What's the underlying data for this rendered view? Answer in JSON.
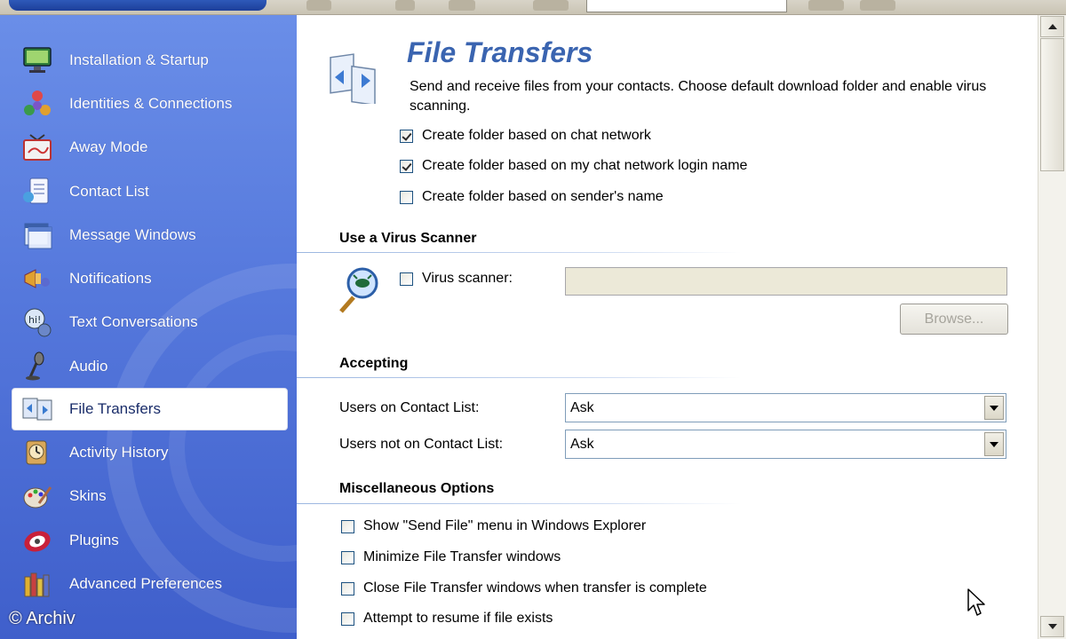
{
  "app": {
    "watermark": "© Archiv"
  },
  "sidebar": {
    "items": [
      {
        "label": "Installation & Startup",
        "icon": "monitor-icon"
      },
      {
        "label": "Identities & Connections",
        "icon": "connections-icon"
      },
      {
        "label": "Away Mode",
        "icon": "away-sign-icon"
      },
      {
        "label": "Contact List",
        "icon": "contact-list-icon"
      },
      {
        "label": "Message Windows",
        "icon": "message-windows-icon"
      },
      {
        "label": "Notifications",
        "icon": "notifications-icon"
      },
      {
        "label": "Text Conversations",
        "icon": "text-conversations-icon"
      },
      {
        "label": "Audio",
        "icon": "microphone-icon"
      },
      {
        "label": "File Transfers",
        "icon": "file-transfers-icon",
        "active": true
      },
      {
        "label": "Activity History",
        "icon": "activity-history-icon"
      },
      {
        "label": "Skins",
        "icon": "skins-icon"
      },
      {
        "label": "Plugins",
        "icon": "plugins-icon"
      },
      {
        "label": "Advanced Preferences",
        "icon": "advanced-preferences-icon"
      }
    ]
  },
  "main": {
    "title": "File Transfers",
    "description": "Send and receive files from your contacts.  Choose default download folder and enable virus scanning.",
    "folder_options": [
      {
        "label": "Create folder based on chat network",
        "checked": true
      },
      {
        "label": "Create folder based on my chat network login name",
        "checked": true
      },
      {
        "label": "Create folder based on sender's name",
        "checked": false
      }
    ],
    "virus": {
      "heading": "Use a Virus Scanner",
      "checkbox_label": "Virus scanner:",
      "checked": false,
      "path_value": "",
      "browse_label": "Browse..."
    },
    "accepting": {
      "heading": "Accepting",
      "on_list_label": "Users on Contact List:",
      "on_list_value": "Ask",
      "off_list_label": "Users not on Contact List:",
      "off_list_value": "Ask"
    },
    "misc": {
      "heading": "Miscellaneous Options",
      "options": [
        {
          "label": "Show \"Send File\" menu in Windows Explorer",
          "checked": false
        },
        {
          "label": "Minimize File Transfer windows",
          "checked": false
        },
        {
          "label": "Close File Transfer windows when transfer is complete",
          "checked": false
        },
        {
          "label": "Attempt to resume if file exists",
          "checked": false
        }
      ]
    }
  },
  "colors": {
    "sidebar": "#5578dc",
    "title": "#3a64b0",
    "accent": "#9bb6e0"
  }
}
